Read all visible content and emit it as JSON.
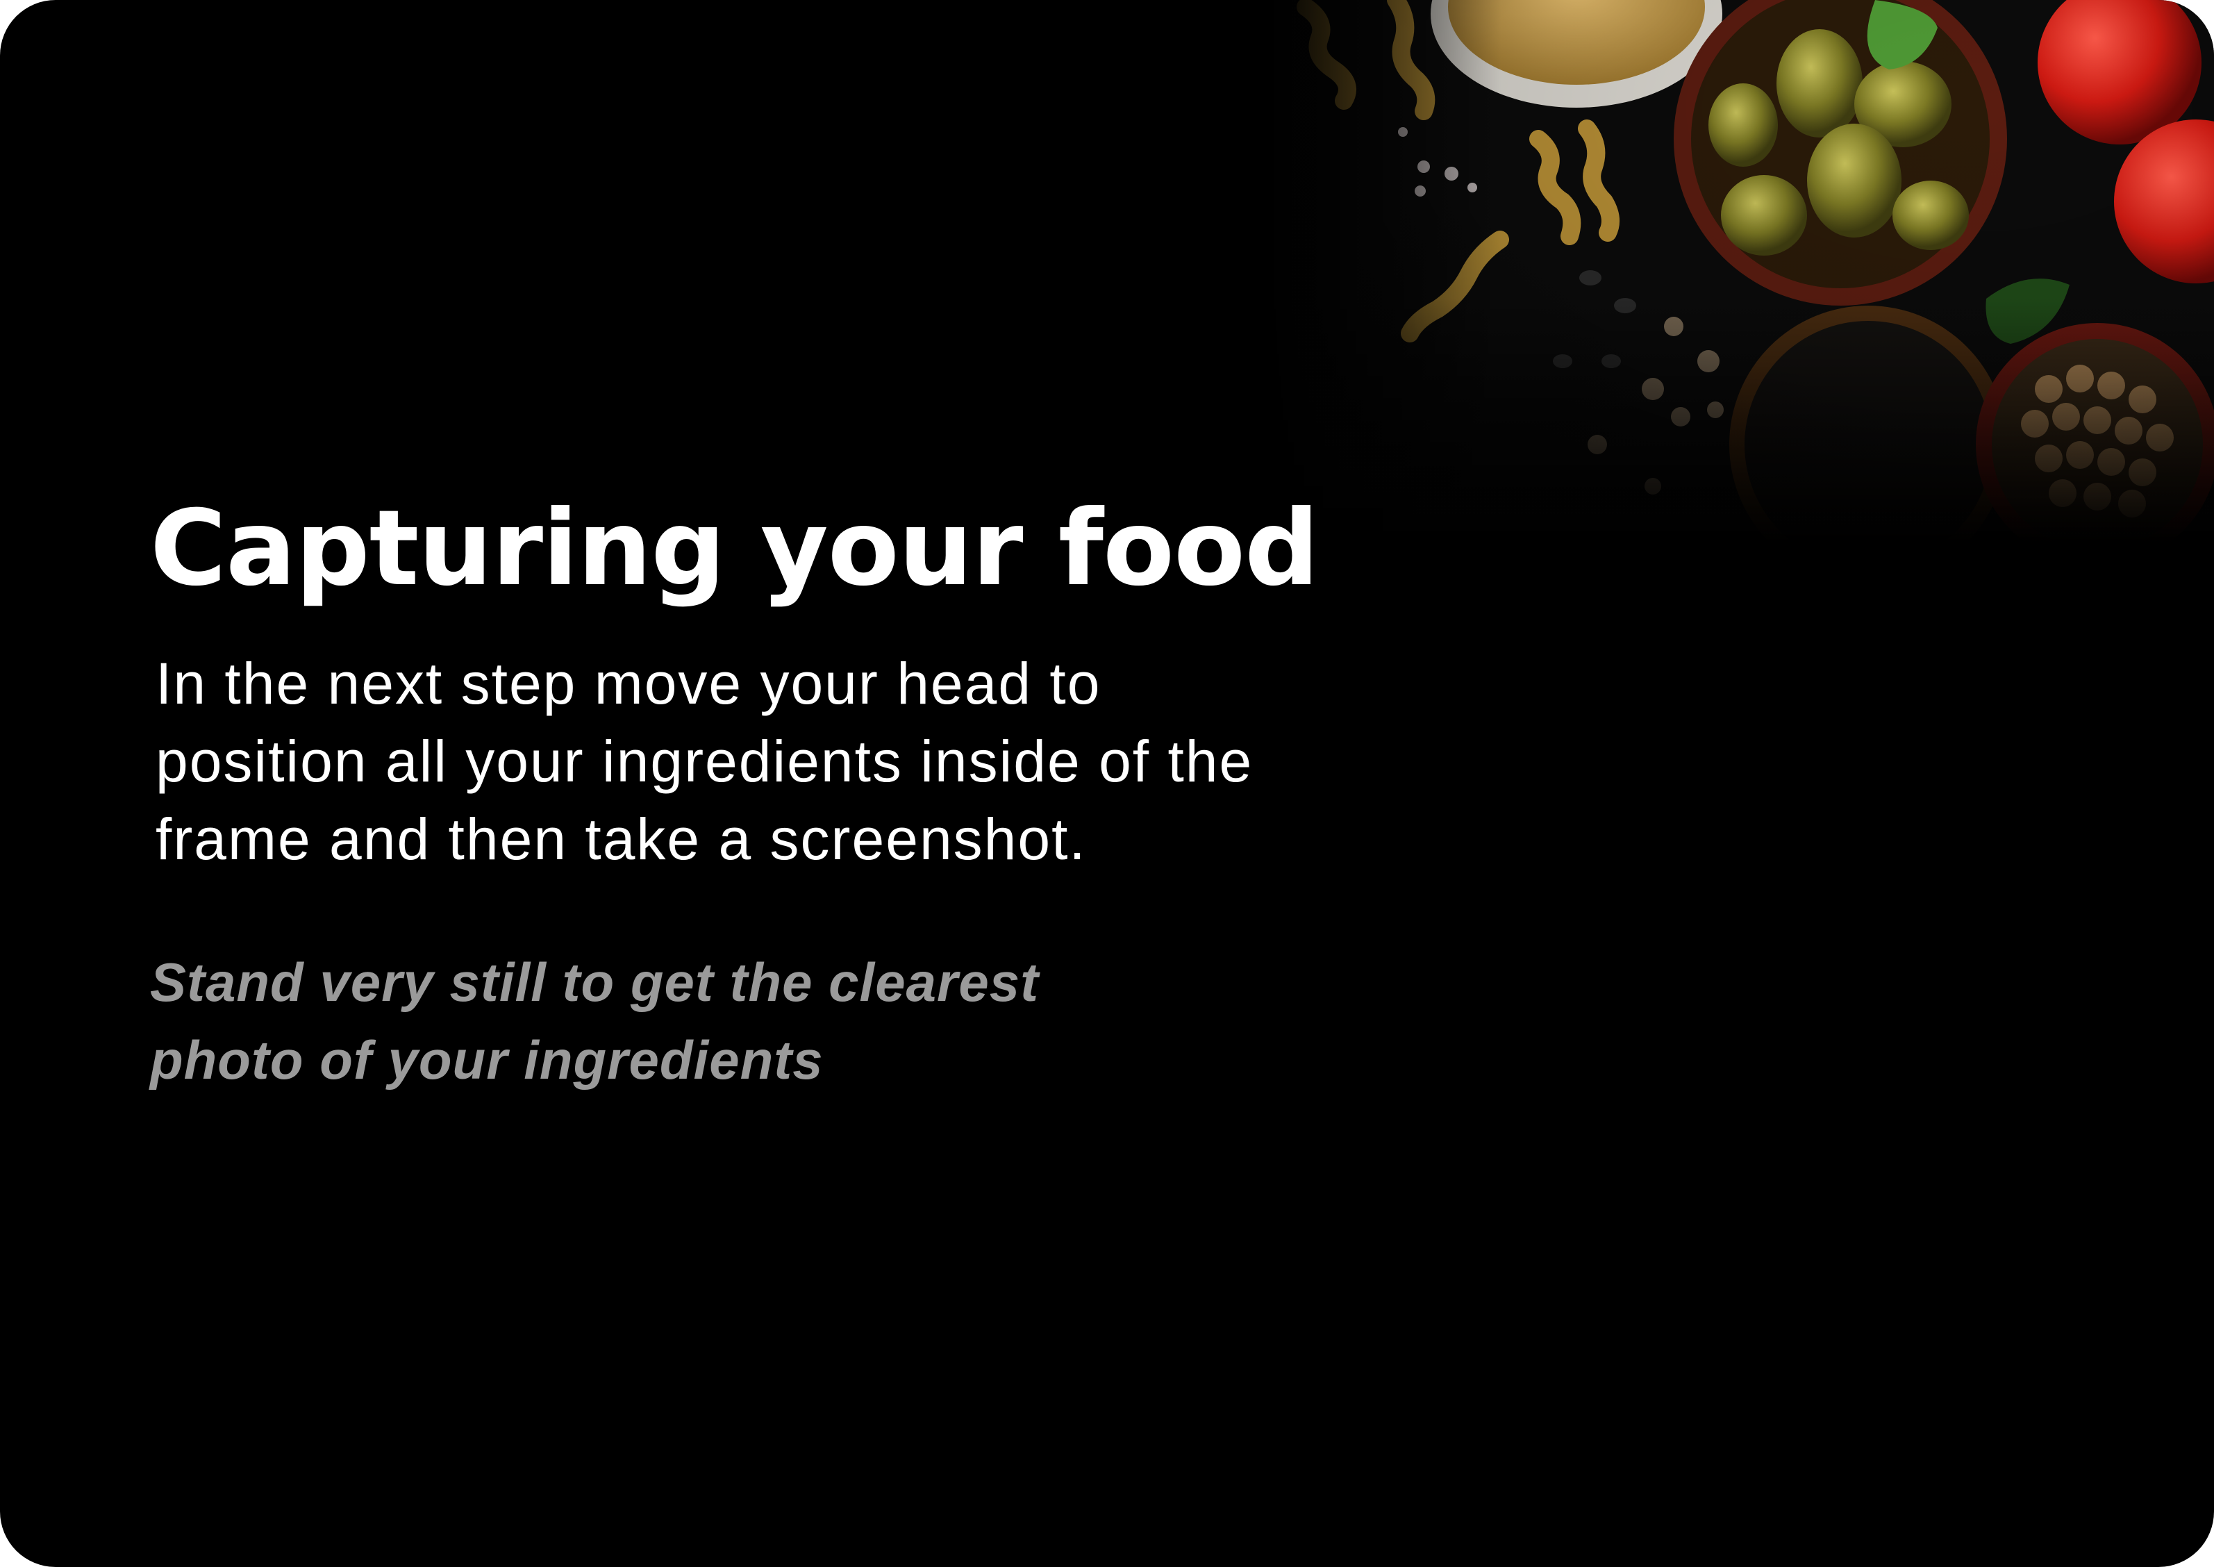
{
  "intro_card": {
    "title": "Capturing your food",
    "body": "In the next step move your head to position all your ingredients inside of the frame and then take a screenshot.",
    "tip": "Stand very still to get the clearest photo of your ingredients"
  },
  "colors": {
    "background": "#000000",
    "title": "#ffffff",
    "body": "#ffffff",
    "tip": "#9a9a9a"
  },
  "icons": {
    "hero": "food-ingredients-photo"
  }
}
